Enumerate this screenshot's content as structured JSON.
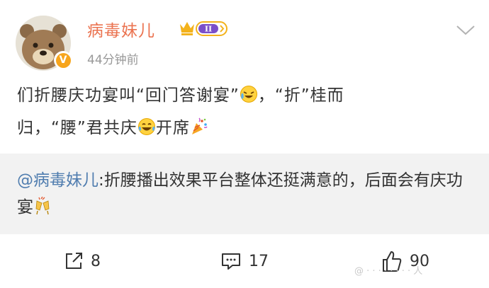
{
  "post": {
    "username": "病毒妹儿",
    "vip_level": "II",
    "timestamp": "44分钟前",
    "text_line1_a": "们折腰庆功宴叫“回门答谢宴”",
    "text_line1_b": "，“折”桂而",
    "text_line2_a": "归，“腰”君共庆",
    "text_line2_b": "开席",
    "emojis": [
      "laughing-tears-emoji",
      "laughing-emoji",
      "party-popper-emoji"
    ]
  },
  "quote": {
    "mention": "@病毒妹儿",
    "text_a": ":折腰播出效果平台整体还挺满意的，后面会有庆功宴",
    "emoji": "cheers-emoji"
  },
  "actions": {
    "repost_count": "8",
    "comment_count": "17",
    "like_count": "90"
  },
  "watermark": "@ · · · · · · · · 人",
  "colors": {
    "username": "#eb7350",
    "mention": "#507daf",
    "quote_bg": "#f2f2f2",
    "badge": "#f7a51c"
  }
}
